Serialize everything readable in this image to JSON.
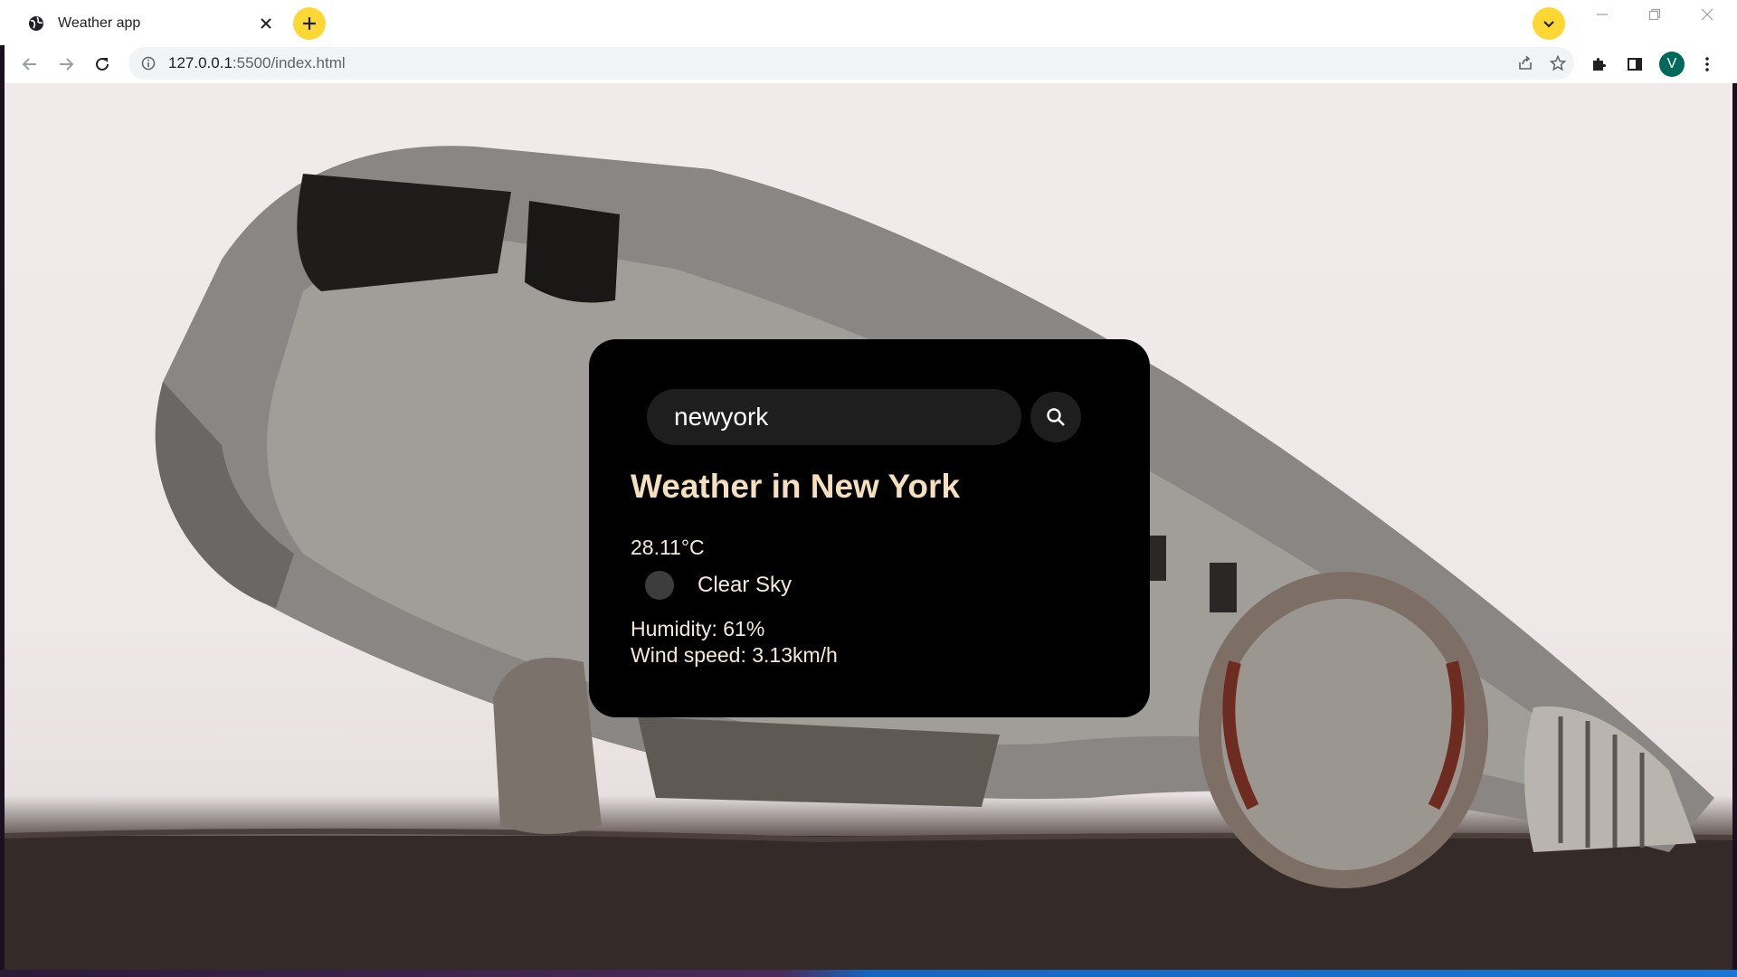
{
  "browser": {
    "tab_title": "Weather app",
    "url_host": "127.0.0.1",
    "url_rest": ":5500/index.html",
    "profile_initial": "V",
    "accent": "#fdd835"
  },
  "weather": {
    "search_value": "newyork",
    "city_heading": "Weather in New York",
    "temperature": "28.11°C",
    "description": "Clear Sky",
    "humidity": "Humidity: 61%",
    "wind": "Wind speed: 3.13km/h",
    "card_color": "#000000",
    "heading_color": "#f5dfbe"
  },
  "icons": {
    "tab_favicon": "globe-icon",
    "tab_close": "close-icon",
    "new_tab": "plus-icon",
    "tab_search": "chevron-down-icon",
    "back": "arrow-left-icon",
    "forward": "arrow-right-icon",
    "reload": "reload-icon",
    "site_info": "info-icon",
    "share": "share-icon",
    "bookmark": "star-icon",
    "extensions": "puzzle-icon",
    "side_panel": "side-panel-icon",
    "menu": "kebab-menu-icon",
    "search": "search-icon",
    "weather": "weather-condition-icon"
  }
}
